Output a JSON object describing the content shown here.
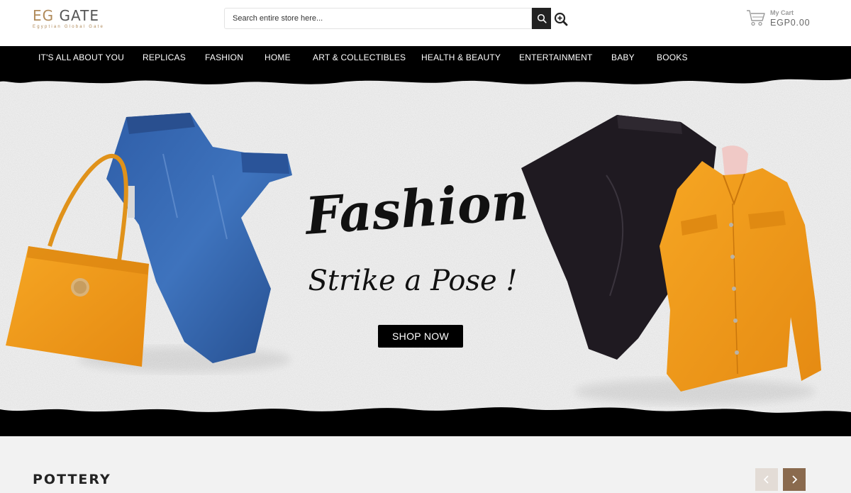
{
  "header": {
    "logo_main_prefix": "EG",
    "logo_main_suffix": " GATE",
    "logo_tagline": "Egyptian Global Gate",
    "search_placeholder": "Search entire store here...",
    "search_icon": "search-icon",
    "advanced_search_icon": "zoom-in-icon",
    "cart_icon": "shopping-cart-icon",
    "cart_label": "My Cart",
    "cart_total": "EGP0.00"
  },
  "nav": {
    "items": [
      "IT'S ALL ABOUT YOU",
      "REPLICAS",
      "FASHION",
      "HOME",
      "ART & COLLECTIBLES",
      "HEALTH & BEAUTY",
      "ENTERTAINMENT",
      "BABY",
      "BOOKS"
    ]
  },
  "banner": {
    "headline": "Fashion",
    "subheadline": "Strike a Pose !",
    "cta_label": "SHOP NOW",
    "images": [
      "orange-tote-bag",
      "blue-jeans",
      "black-jeans",
      "orange-denim-jacket"
    ]
  },
  "section": {
    "title": "POTTERY",
    "prev_icon": "chevron-left-icon",
    "next_icon": "chevron-right-icon"
  },
  "colors": {
    "accent": "#b08a5a",
    "nav_bg": "#000000",
    "carousel_next": "#8a6a4e",
    "carousel_prev": "#e3dcd6"
  }
}
